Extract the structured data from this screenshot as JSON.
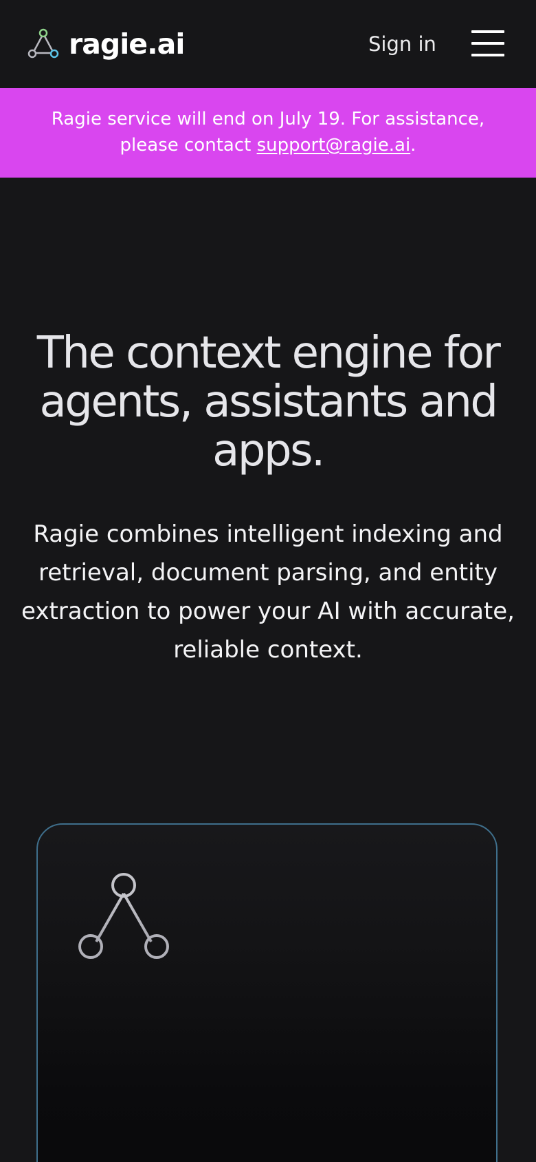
{
  "header": {
    "logo_text": "ragie.ai",
    "logo_icon": "triangle-nodes-icon",
    "signin_label": "Sign in",
    "menu_icon": "hamburger-menu-icon"
  },
  "banner": {
    "text_before": "Ragie service will end on July 19. For assistance, please contact ",
    "link_text": "support@ragie.ai",
    "text_after": ".",
    "background_color": "#d946ef"
  },
  "hero": {
    "title": "The context engine for agents, assistants and apps.",
    "subtitle": "Ragie combines intelligent indexing and retrieval, document parsing, and entity extraction to power your AI with accurate, reliable context."
  },
  "card": {
    "icon": "triangle-nodes-icon",
    "border_color": "#3f6f8c"
  },
  "colors": {
    "background": "#161618",
    "accent_banner": "#d946ef",
    "logo_node_green": "#8fd48b",
    "logo_node_blue": "#5bc4e8",
    "logo_node_gray": "#b9b9c0"
  }
}
